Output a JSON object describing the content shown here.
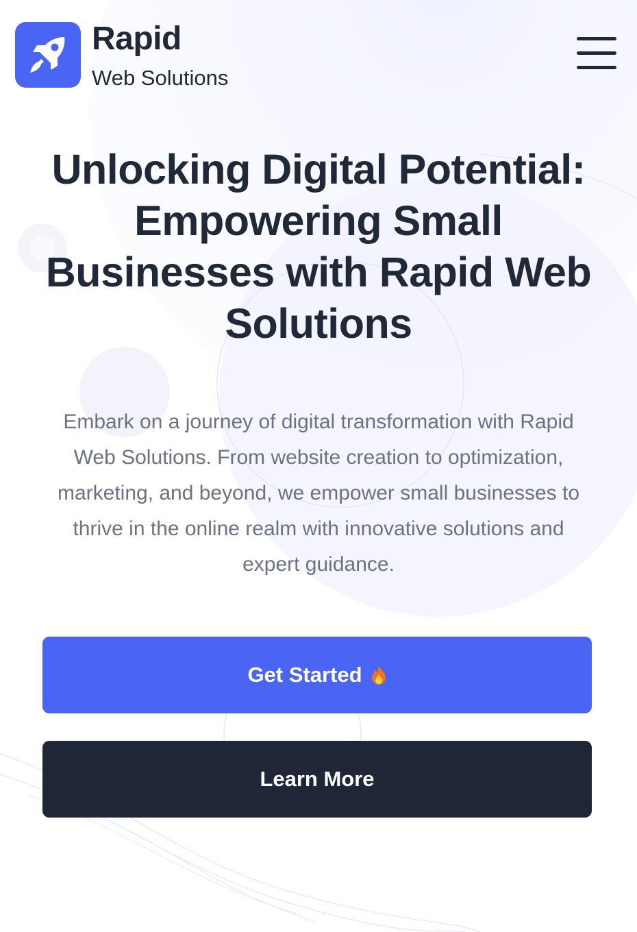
{
  "header": {
    "brand_name": "Rapid",
    "brand_tagline": "Web Solutions",
    "logo_icon": "rocket-icon",
    "menu_icon": "hamburger-menu-icon"
  },
  "hero": {
    "title": "Unlocking Digital Potential: Empowering Small Businesses with Rapid Web Solutions",
    "description": "Embark on a journey of digital transformation with Rapid Web Solutions. From website creation to optimization, marketing, and beyond, we empower small businesses to thrive in the online realm with innovative solutions and expert guidance.",
    "primary_button": "Get Started",
    "primary_button_icon": "fire-icon",
    "secondary_button": "Learn More"
  },
  "colors": {
    "accent": "#4a64f4",
    "dark": "#1f2737",
    "text": "#1f2937",
    "muted_text": "#6b7280"
  }
}
